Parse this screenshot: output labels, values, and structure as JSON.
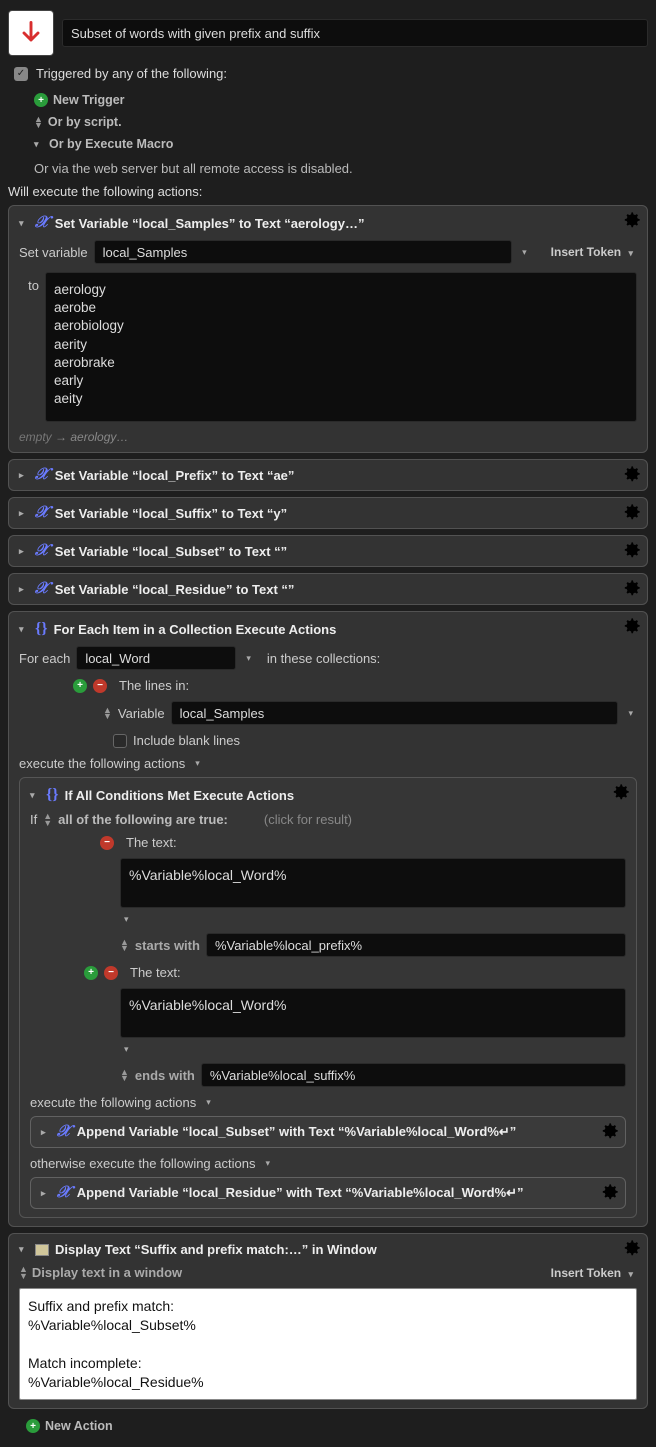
{
  "macro": {
    "title": "Subset of words with given prefix and suffix"
  },
  "trigger": {
    "label": "Triggered by any of the following:",
    "new_trigger": "New Trigger",
    "or_script": "Or by script.",
    "or_execute": "Or by Execute Macro",
    "server_note": "Or via the web server but all remote access is disabled."
  },
  "section": {
    "will_execute": "Will execute the following actions:"
  },
  "act1": {
    "title": "Set Variable “local_Samples” to Text “aerology…”",
    "set_variable_label": "Set variable",
    "var_name": "local_Samples",
    "insert_token": "Insert Token",
    "to_label": "to",
    "text_value": "aerology\naerobe\naerobiology\naerity\naerobrake\nearly\naeity",
    "footer_empty": "empty",
    "footer_result": "aerology…"
  },
  "act2": {
    "title": "Set Variable “local_Prefix” to Text “ae”"
  },
  "act3": {
    "title": "Set Variable “local_Suffix” to Text “y”"
  },
  "act4": {
    "title": "Set Variable “local_Subset” to Text “”"
  },
  "act5": {
    "title": "Set Variable “local_Residue” to Text “”"
  },
  "for_each": {
    "title": "For Each Item in a Collection Execute Actions",
    "for_each_label": "For each",
    "var_name": "local_Word",
    "in_collections": "in these collections:",
    "lines_in": "The lines in:",
    "variable_label": "Variable",
    "lines_source": "local_Samples",
    "include_blank": "Include blank lines",
    "execute_label": "execute the following actions"
  },
  "if_block": {
    "title": "If All Conditions Met Execute Actions",
    "if_label": "If",
    "all_true": "all of the following are true:",
    "click_result": "(click for result)",
    "the_text": "The text:",
    "cond1_value": "%Variable%local_Word%",
    "starts_with": "starts with",
    "cond1_rhs": "%Variable%local_prefix%",
    "cond2_value": "%Variable%local_Word%",
    "ends_with": "ends with",
    "cond2_rhs": "%Variable%local_suffix%",
    "execute_label": "execute the following actions",
    "otherwise_label": "otherwise execute the following actions",
    "append_subset": "Append Variable “local_Subset” with Text “%Variable%local_Word%↵”",
    "append_residue": "Append Variable “local_Residue” with Text “%Variable%local_Word%↵”"
  },
  "display": {
    "title": "Display Text “Suffix and prefix match:…” in Window",
    "mode": "Display text in a window",
    "insert_token": "Insert Token",
    "body": "Suffix and prefix match:\n%Variable%local_Subset%\n\nMatch incomplete:\n%Variable%local_Residue%"
  },
  "footer": {
    "new_action": "New Action"
  }
}
